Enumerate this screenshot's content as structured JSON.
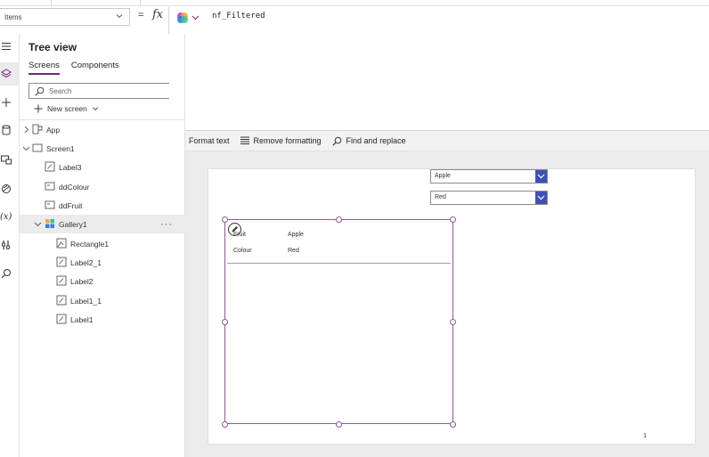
{
  "property_selector": {
    "value": "Items"
  },
  "formula_bar": {
    "equals": "=",
    "fx": "fx",
    "code": "nf_Filtered"
  },
  "format_toolbar": {
    "format_text": "Format text",
    "remove_formatting": "Remove formatting",
    "find_replace": "Find and replace"
  },
  "left_rail": {
    "icons": [
      "hamburger-icon",
      "layers-icon",
      "plus-icon",
      "database-icon",
      "media-icon",
      "paint-icon",
      "variables-icon",
      "tools-icon",
      "search-icon"
    ]
  },
  "tree_view": {
    "title": "Tree view",
    "tabs": [
      {
        "label": "Screens",
        "active": true
      },
      {
        "label": "Components",
        "active": false
      }
    ],
    "search_placeholder": "Search",
    "new_screen": "New screen",
    "nodes": [
      {
        "label": "App",
        "icon": "app-icon"
      },
      {
        "label": "Screen1",
        "icon": "screen-icon"
      },
      {
        "label": "Label3",
        "icon": "label-icon"
      },
      {
        "label": "ddColour",
        "icon": "dropdown-icon"
      },
      {
        "label": "ddFruit",
        "icon": "dropdown-icon"
      },
      {
        "label": "Gallery1",
        "icon": "gallery-icon",
        "selected": true,
        "more": "···"
      },
      {
        "label": "Rectangle1",
        "icon": "rectangle-icon"
      },
      {
        "label": "Label2_1",
        "icon": "label-icon"
      },
      {
        "label": "Label2",
        "icon": "label-icon"
      },
      {
        "label": "Label1_1",
        "icon": "label-icon"
      },
      {
        "label": "Label1",
        "icon": "label-icon"
      }
    ]
  },
  "canvas": {
    "dropdown_fruit": {
      "value": "Apple"
    },
    "dropdown_colour": {
      "value": "Red"
    },
    "gallery": {
      "fruit_label": "Fruit",
      "fruit_value": "Apple",
      "colour_label": "Colour",
      "colour_value": "Red"
    },
    "page_number": "1"
  },
  "colors": {
    "accent": "#742774",
    "dropdown_button": "#3f51b5",
    "selection": "#8e5b8e"
  }
}
